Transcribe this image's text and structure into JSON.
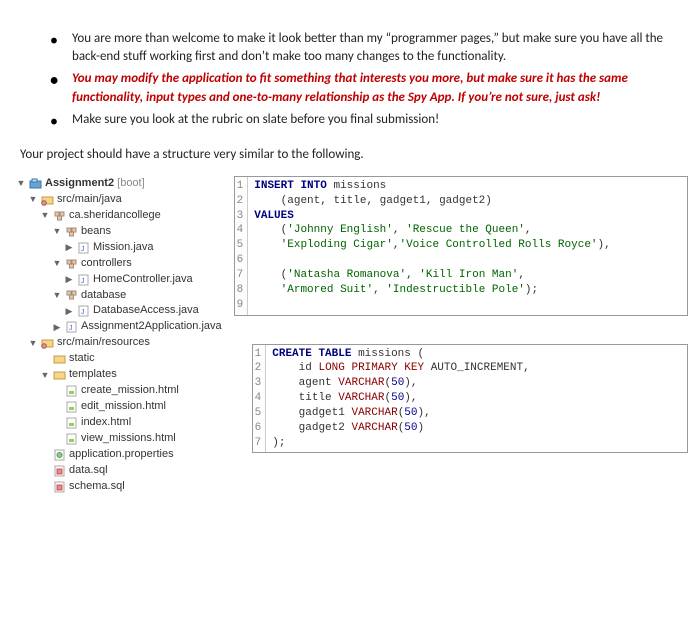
{
  "bullets": {
    "b1": "You are more than welcome to make it look better than my “programmer pages,” but make sure you have all the back-end stuff working first and don’t make too many changes to the functionality.",
    "b2": "You may modify the application to fit something that interests you more, but make sure it has the same functionality, input types and one-to-many relationship as the Spy App. If you’re not sure, just ask!",
    "b3": "Make sure you look at the rubric on slate before you final submission!"
  },
  "lead": "Your project should have a structure very similar to the following.",
  "tree": {
    "root_name": "Assignment2",
    "root_suffix": "[boot]",
    "srcmainjava": "src/main/java",
    "pkg": "ca.sheridancollege",
    "beans": "beans",
    "mission_java": "Mission.java",
    "controllers": "controllers",
    "homecontroller": "HomeController.java",
    "database": "database",
    "databaseaccess": "DatabaseAccess.java",
    "app_java": "Assignment2Application.java",
    "srcmainres": "src/main/resources",
    "static": "static",
    "templates": "templates",
    "create_html": "create_mission.html",
    "edit_html": "edit_mission.html",
    "index_html": "index.html",
    "view_html": "view_missions.html",
    "app_props": "application.properties",
    "data_sql": "data.sql",
    "schema_sql": "schema.sql"
  },
  "code1": {
    "gutter": "1\n2\n3\n4\n5\n6\n7\n8\n9",
    "L1a": "INSERT INTO",
    "L1b": " missions",
    "L2": "    (agent, title, gadget1, gadget2)",
    "L3": "VALUES",
    "L4a": "    (",
    "L4b": "'Johnny English'",
    "L4c": ", ",
    "L4d": "'Rescue the Queen'",
    "L4e": ",",
    "L5a": "    ",
    "L5b": "'Exploding Cigar'",
    "L5c": ",",
    "L5d": "'Voice Controlled Rolls Royce'",
    "L5e": "),",
    "L7a": "    (",
    "L7b": "'Natasha Romanova'",
    "L7c": ", ",
    "L7d": "'Kill Iron Man'",
    "L7e": ",",
    "L8a": "    ",
    "L8b": "'Armored Suit'",
    "L8c": ", ",
    "L8d": "'Indestructible Pole'",
    "L8e": ");"
  },
  "code2": {
    "gutter": "1\n2\n3\n4\n5\n6\n7",
    "L1a": "CREATE TABLE",
    "L1b": " missions (",
    "L2a": "    id ",
    "L2b": "LONG PRIMARY KEY",
    "L2c": " AUTO_INCREMENT,",
    "L3a": "    agent ",
    "L3b": "VARCHAR",
    "L3c": "(",
    "L3d": "50",
    "L3e": "),",
    "L4a": "    title ",
    "L4b": "VARCHAR",
    "L4c": "(",
    "L4d": "50",
    "L4e": "),",
    "L5a": "    gadget1 ",
    "L5b": "VARCHAR",
    "L5c": "(",
    "L5d": "50",
    "L5e": "),",
    "L6a": "    gadget2 ",
    "L6b": "VARCHAR",
    "L6c": "(",
    "L6d": "50",
    "L6e": ")",
    "L7": ");"
  }
}
